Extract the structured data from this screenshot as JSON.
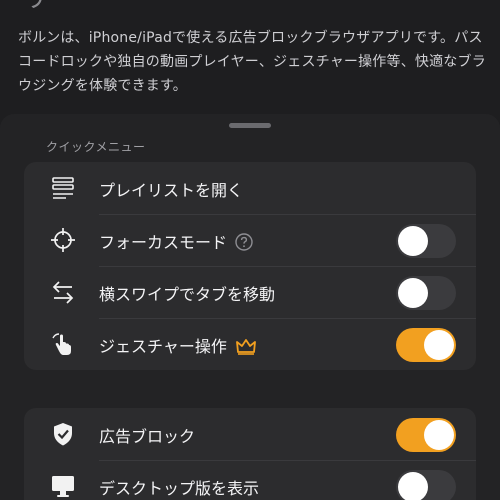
{
  "background": {
    "title_fragment": "リ",
    "description": "ボルンは、iPhone/iPadで使える広告ブロックブラウザアプリです。パスコードロックや独自の動画プレイヤー、ジェスチャー操作等、快適なブラウジングを体験できます。"
  },
  "sheet": {
    "section_title": "クイックメニュー",
    "quick_menu": [
      {
        "label": "プレイリストを開く",
        "icon": "playlist-icon"
      },
      {
        "label": "フォーカスモード",
        "icon": "crosshair-icon",
        "badge": "help-icon",
        "toggle": false
      },
      {
        "label": "横スワイプでタブを移動",
        "icon": "swap-arrows-icon",
        "toggle": false
      },
      {
        "label": "ジェスチャー操作",
        "icon": "hand-tap-icon",
        "badge": "crown-icon",
        "toggle": true
      }
    ],
    "settings": [
      {
        "label": "広告ブロック",
        "icon": "shield-check-icon",
        "toggle": true
      },
      {
        "label": "デスクトップ版を表示",
        "icon": "desktop-icon",
        "toggle": false
      }
    ]
  },
  "colors": {
    "accent": "#f2a020",
    "toggle_off": "#3b3b3e",
    "crown": "#f2a020"
  }
}
